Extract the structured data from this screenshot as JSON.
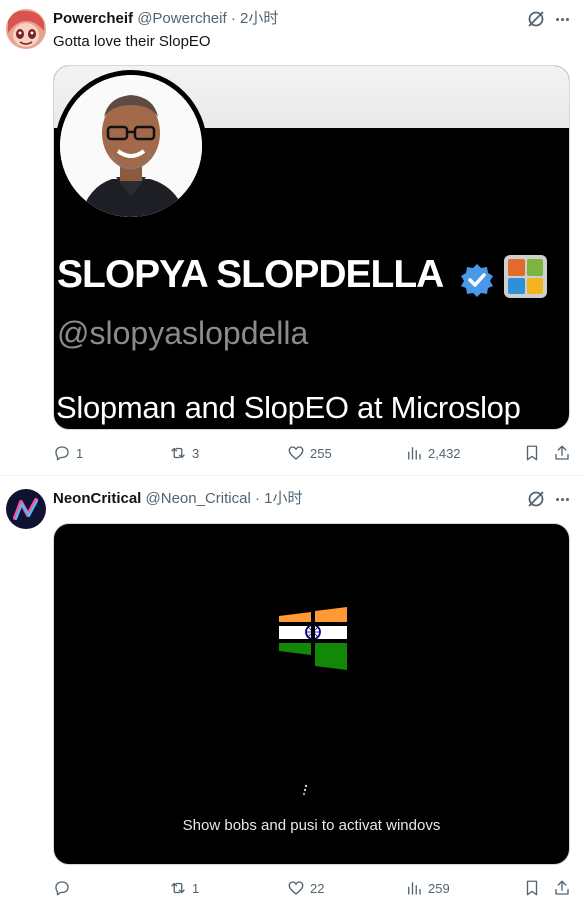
{
  "tweets": [
    {
      "display_name": "Powercheif",
      "handle": "@Powercheif",
      "separator": "·",
      "time": "2小时",
      "text": "Gotta love their SlopEO",
      "media": {
        "name": "SLOPYA SLOPDELLA",
        "handle": "@slopyaslopdella",
        "bio": "Slopman and SlopEO at Microslop"
      },
      "actions": {
        "replies": "1",
        "reposts": "3",
        "likes": "255",
        "views": "2,432"
      }
    },
    {
      "display_name": "NeonCritical",
      "handle": "@Neon_Critical",
      "separator": "·",
      "time": "1小时",
      "media": {
        "caption": "Show bobs and pusi to activat windovs"
      },
      "actions": {
        "replies": "",
        "reposts": "1",
        "likes": "22",
        "views": "259"
      }
    }
  ],
  "icons": {
    "reply": "reply-icon",
    "repost": "repost-icon",
    "like": "heart-icon",
    "views": "views-icon",
    "bookmark": "bookmark-icon",
    "share": "share-icon",
    "grok": "grok-icon",
    "more": "more-icon"
  },
  "colors": {
    "text": "#0f1419",
    "secondary": "#536471",
    "verified": "#4a99e9",
    "flag_saffron": "#ff9933",
    "flag_green": "#138808",
    "chakra": "#000080"
  }
}
